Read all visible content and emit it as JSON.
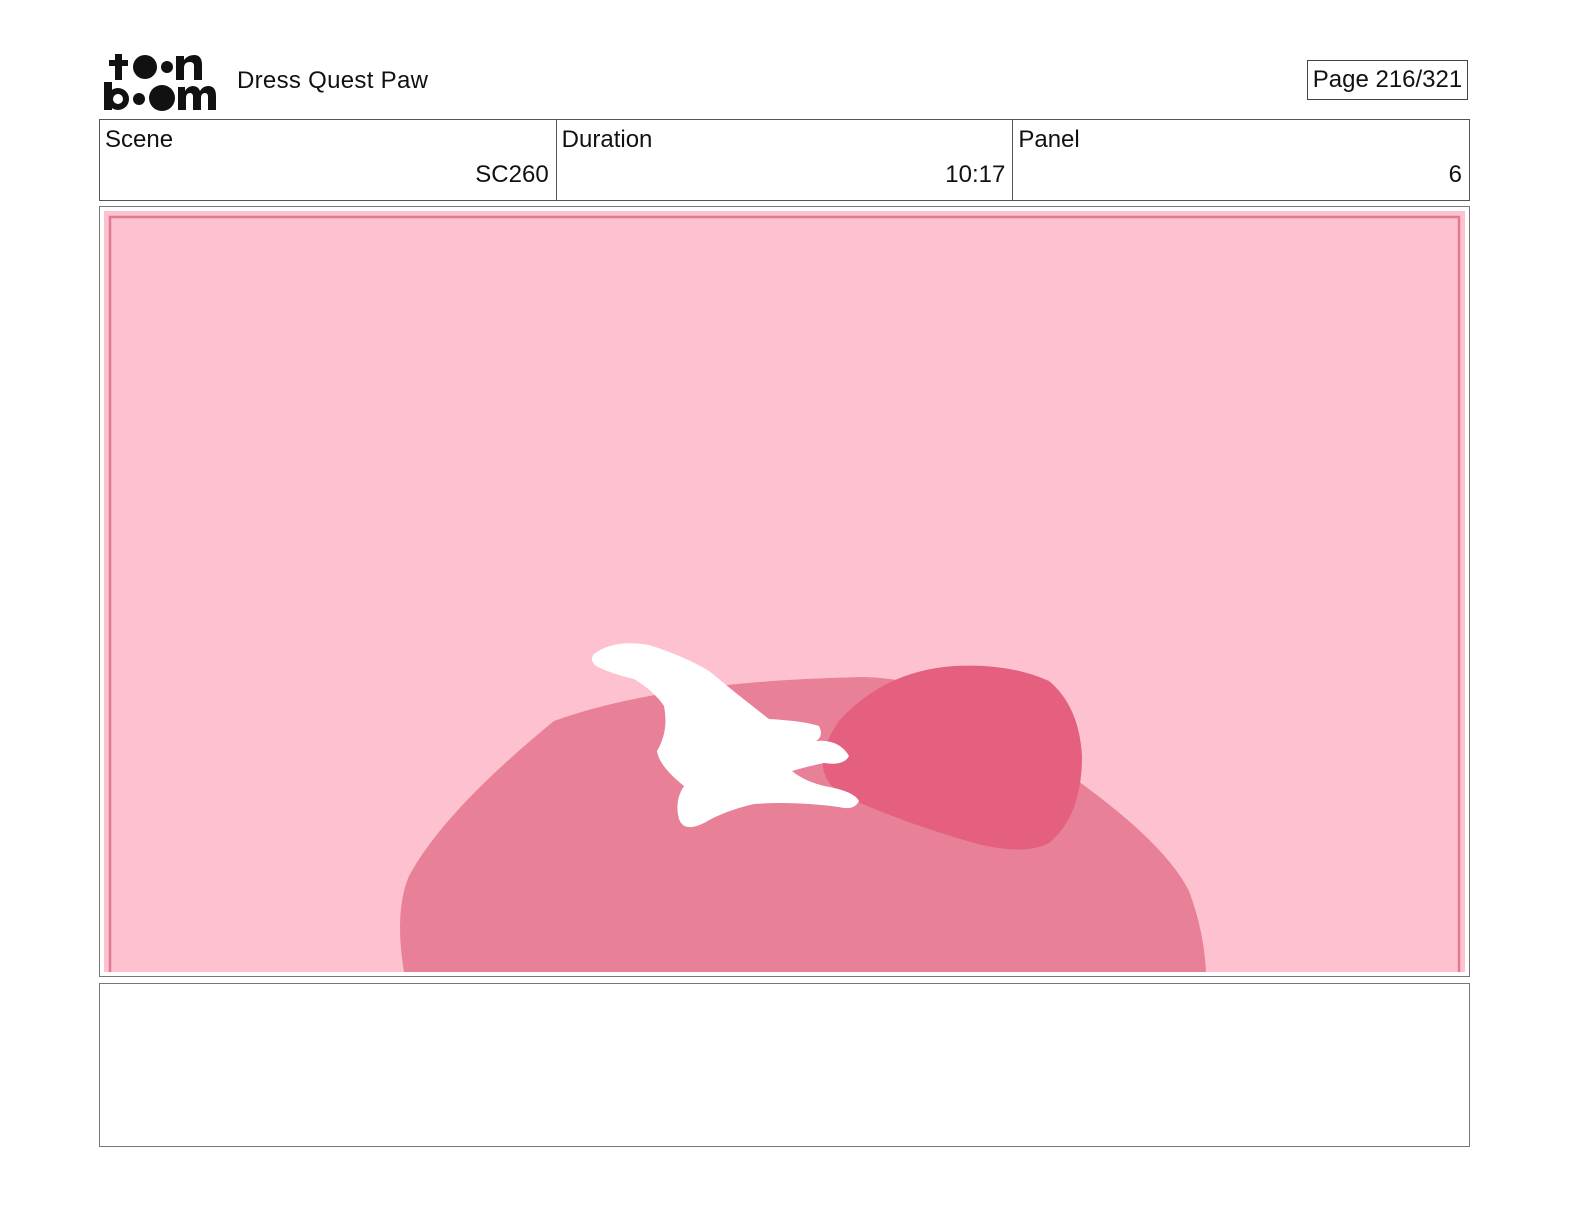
{
  "header": {
    "logo_text": "toonboom",
    "project_title": "Dress Quest Paw",
    "page_label": "Page 216/321"
  },
  "info": {
    "scene_label": "Scene",
    "scene_value": "SC260",
    "duration_label": "Duration",
    "duration_value": "10:17",
    "panel_label": "Panel",
    "panel_value": "6"
  },
  "panel": {
    "background_color": "#fdc1cf",
    "safe_frame_color": "#e07a8f",
    "body_color": "#e88097",
    "head_color": "#e55f7e",
    "highlight_color": "#ffffff"
  },
  "notes": {
    "text": ""
  }
}
